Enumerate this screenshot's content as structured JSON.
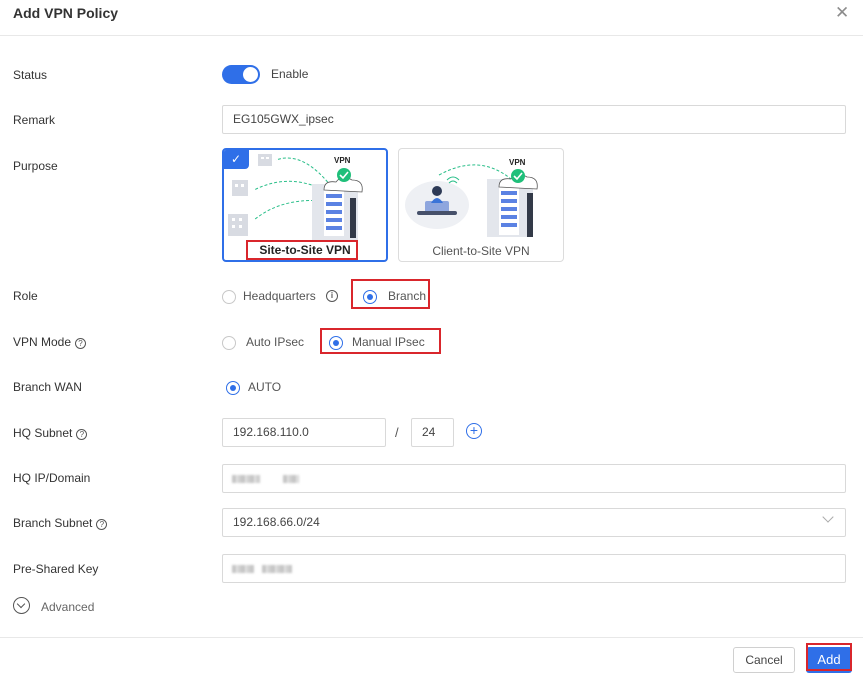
{
  "dialog": {
    "title": "Add VPN Policy"
  },
  "status": {
    "label": "Status",
    "toggle_text": "Enable",
    "enabled": true
  },
  "remark": {
    "label": "Remark",
    "value": "EG105GWX_ipsec"
  },
  "purpose": {
    "label": "Purpose",
    "options": [
      {
        "caption": "Site-to-Site VPN",
        "badge": "VPN",
        "selected": true
      },
      {
        "caption": "Client-to-Site VPN",
        "badge": "VPN",
        "selected": false
      }
    ]
  },
  "role": {
    "label": "Role",
    "options": [
      "Headquarters",
      "Branch"
    ],
    "selected": "Branch"
  },
  "vpn_mode": {
    "label": "VPN Mode",
    "options": [
      "Auto IPsec",
      "Manual IPsec"
    ],
    "selected": "Manual IPsec"
  },
  "branch_wan": {
    "label": "Branch WAN",
    "value": "AUTO"
  },
  "hq_subnet": {
    "label": "HQ Subnet",
    "ip": "192.168.110.0",
    "separator": "/",
    "mask": "24"
  },
  "hq_ip_domain": {
    "label": "HQ IP/Domain"
  },
  "branch_subnet": {
    "label": "Branch Subnet",
    "value": "192.168.66.0/24"
  },
  "pre_shared_key": {
    "label": "Pre-Shared Key"
  },
  "advanced": {
    "label": "Advanced"
  },
  "footer": {
    "cancel": "Cancel",
    "add": "Add"
  },
  "colors": {
    "accent": "#2f6fe8",
    "highlight": "#d9262c",
    "check": "#1fbf7a"
  }
}
